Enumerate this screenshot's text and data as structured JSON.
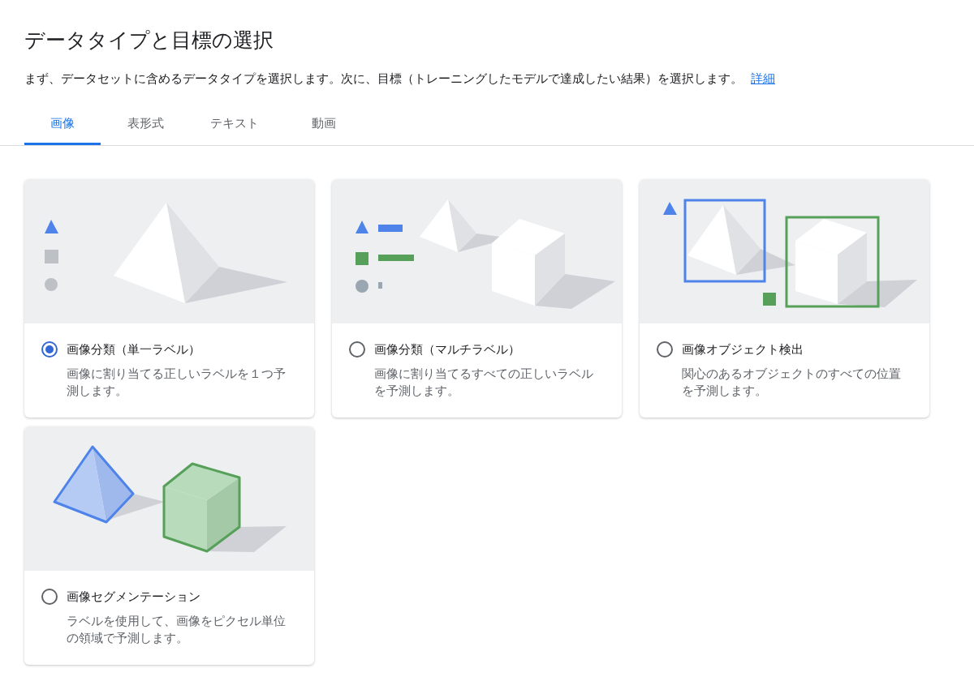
{
  "header": {
    "title": "データタイプと目標の選択",
    "description": "まず、データセットに含めるデータタイプを選択します。次に、目標（トレーニングしたモデルで達成したい結果）を選択します。",
    "link": "詳細"
  },
  "tabs": [
    {
      "label": "画像",
      "selected": true
    },
    {
      "label": "表形式",
      "selected": false
    },
    {
      "label": "テキスト",
      "selected": false
    },
    {
      "label": "動画",
      "selected": false
    }
  ],
  "objectives": [
    {
      "kind": "classification",
      "title": "画像分類（単一ラベル）",
      "description": "画像に割り当てる正しいラベルを１つ予測します。",
      "selected": true
    },
    {
      "kind": "multilabel",
      "title": "画像分類（マルチラベル）",
      "description": "画像に割り当てるすべての正しいラベルを予測します。",
      "selected": false
    },
    {
      "kind": "detection",
      "title": "画像オブジェクト検出",
      "description": "関心のあるオブジェクトのすべての位置を予測します。",
      "selected": false
    },
    {
      "kind": "segmentation",
      "title": "画像セグメンテーション",
      "description": "ラベルを使用して、画像をピクセル単位の領域で予測します。",
      "selected": false
    }
  ]
}
